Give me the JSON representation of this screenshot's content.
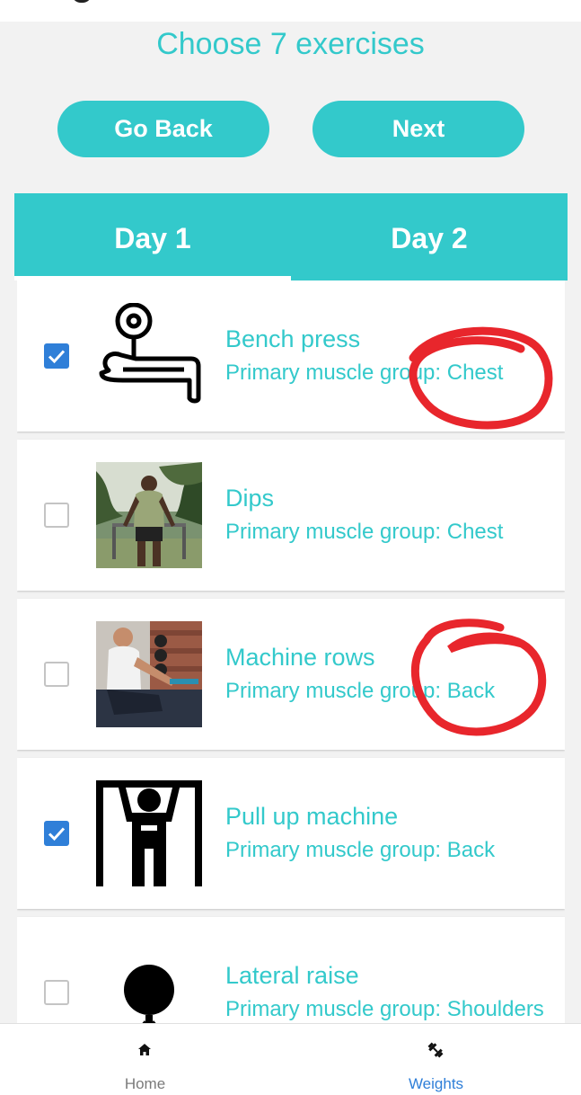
{
  "header": {
    "title": "Choose 7 exercises",
    "back_label": "Go Back",
    "next_label": "Next"
  },
  "tabs": [
    {
      "label": "Day 1",
      "selected": true
    },
    {
      "label": "Day 2",
      "selected": false
    }
  ],
  "exercises": [
    {
      "name": "Bench press",
      "muscle": "Primary muscle group: Chest",
      "checked": true,
      "image": "bench-press-icon"
    },
    {
      "name": "Dips",
      "muscle": "Primary muscle group: Chest",
      "checked": false,
      "image": "dips-photo"
    },
    {
      "name": "Machine rows",
      "muscle": "Primary muscle group: Back",
      "checked": false,
      "image": "machine-rows-photo"
    },
    {
      "name": "Pull up machine",
      "muscle": "Primary muscle group: Back",
      "checked": true,
      "image": "pull-up-icon"
    },
    {
      "name": "Lateral raise",
      "muscle": "Primary muscle group: Shoulders",
      "checked": false,
      "image": "lateral-raise-icon"
    }
  ],
  "bottom_nav": [
    {
      "label": "Home",
      "icon": "home-icon",
      "active": false
    },
    {
      "label": "Weights",
      "icon": "weights-icon",
      "active": true
    }
  ],
  "colors": {
    "accent": "#33c9cb",
    "checkbox_checked": "#2f7fd8",
    "nav_active": "#2f7fd8",
    "annotation": "#e8262c"
  }
}
